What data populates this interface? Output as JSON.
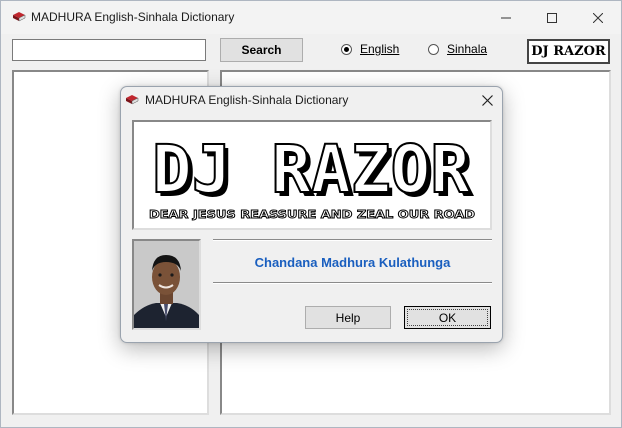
{
  "app": {
    "title": "MADHURA English-Sinhala Dictionary",
    "title_icon": "book-icon"
  },
  "toolbar": {
    "search_value": "",
    "search_button": "Search",
    "radio_english": {
      "label": "English",
      "checked": true
    },
    "radio_sinhala": {
      "label": "Sinhala",
      "checked": false
    },
    "logo_text": "DJ RAZOR"
  },
  "dialog": {
    "title": "MADHURA English-Sinhala Dictionary",
    "banner_title": "DJ RAZOR",
    "banner_tagline": "DEAR JESUS REASSURE AND ZEAL OUR ROAD",
    "author": "Chandana Madhura Kulathunga",
    "help_button": "Help",
    "ok_button": "OK"
  },
  "colors": {
    "accent_text": "#1a5fbf",
    "window_bg": "#f0f0f0"
  }
}
